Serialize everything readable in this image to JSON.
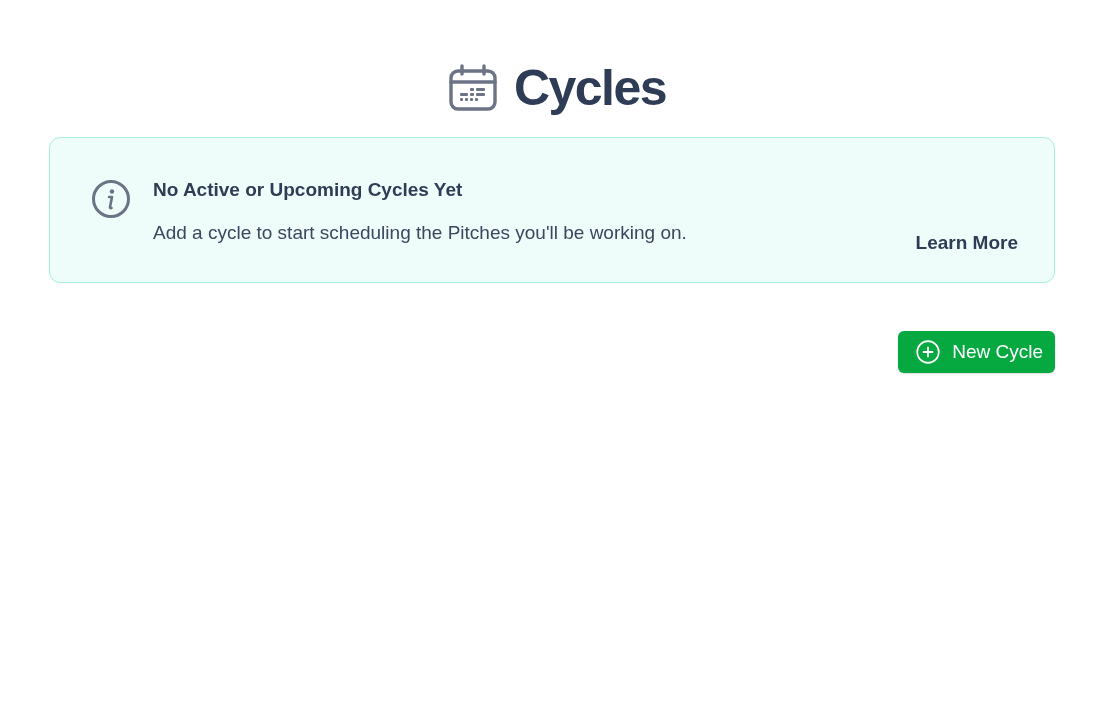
{
  "header": {
    "title": "Cycles"
  },
  "banner": {
    "title": "No Active or Upcoming Cycles Yet",
    "message": "Add a cycle to start scheduling the Pitches you'll be working on.",
    "link": "Learn More"
  },
  "new_cycle_button": {
    "label": "New Cycle"
  }
}
